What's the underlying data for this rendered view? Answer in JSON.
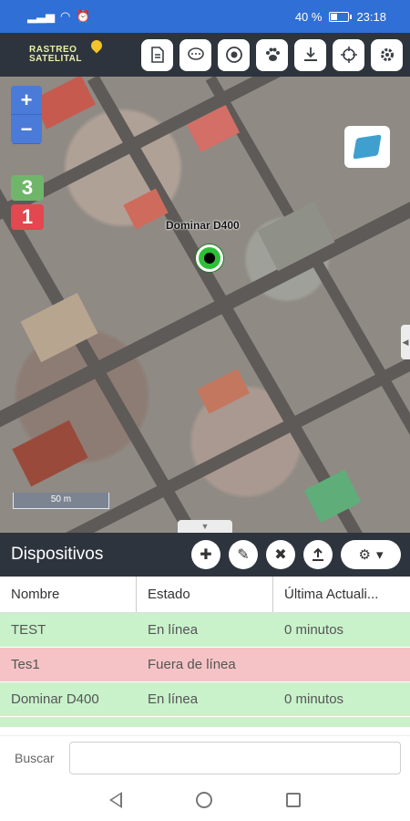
{
  "status_bar": {
    "battery": "40 %",
    "time": "23:18"
  },
  "app": {
    "logo_line1": "RASTREO",
    "logo_line2": "SATELITAL",
    "toolbar_icons": [
      "document-icon",
      "chat-icon",
      "target-icon",
      "paw-icon",
      "download-icon",
      "crosshair-icon",
      "gear-icon"
    ]
  },
  "map": {
    "zoom_in": "+",
    "zoom_out": "−",
    "online_count": "3",
    "offline_count": "1",
    "device_label": "Dominar D400",
    "scale": "50 m"
  },
  "devices_panel": {
    "title": "Dispositivos",
    "columns": [
      "Nombre",
      "Estado",
      "Última Actuali..."
    ],
    "rows": [
      {
        "name": "TEST",
        "state": "En línea",
        "last": "0 minutos",
        "status": "online"
      },
      {
        "name": "Tes1",
        "state": "Fuera de línea",
        "last": "",
        "status": "offline"
      },
      {
        "name": "Dominar D400",
        "state": "En línea",
        "last": "0 minutos",
        "status": "online"
      }
    ],
    "search_label": "Buscar",
    "search_value": "",
    "colors": {
      "online": "#c9f2cb",
      "offline": "#f5c3c6",
      "header": "#2e343d",
      "status_bar": "#2f6fd6"
    }
  }
}
